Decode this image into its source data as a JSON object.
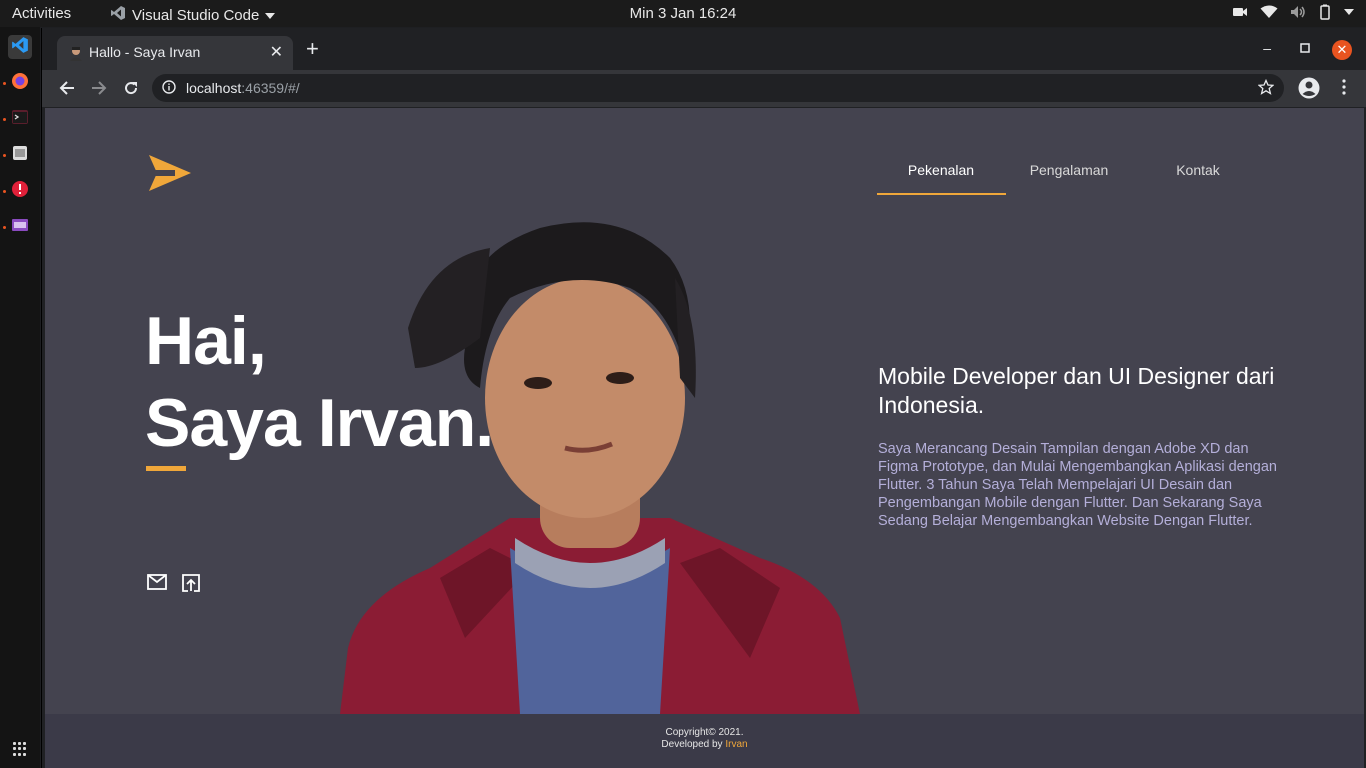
{
  "topbar": {
    "activities": "Activities",
    "app_name": "Visual Studio Code",
    "clock": "Min  3 Jan  16:24"
  },
  "browser": {
    "tab_title": "Hallo - Saya Irvan",
    "url_host": "localhost",
    "url_rest": ":46359/#/"
  },
  "site": {
    "nav": [
      "Pekenalan",
      "Pengalaman",
      "Kontak"
    ],
    "hero_line1": "Hai,",
    "hero_line2": "Saya Irvan.",
    "headline": "Mobile Developer dan UI Designer dari Indonesia.",
    "description": "Saya Merancang Desain Tampilan dengan Adobe XD dan Figma Prototype, dan Mulai Mengembangkan Aplikasi dengan Flutter. 3 Tahun Saya Telah Mempelajari UI Desain dan Pengembangan Mobile dengan Flutter. Dan Sekarang Saya Sedang Belajar Mengembangkan Website Dengan Flutter.",
    "footer_line1": "Copyright© 2021.",
    "footer_prefix": "Developed by ",
    "footer_name": "Irvan"
  },
  "colors": {
    "accent": "#f0a73a",
    "page_bg": "#44434f",
    "footer_bg": "#3b3a48",
    "description": "#b4afd9"
  },
  "icons": [
    "vscode-icon",
    "firefox-icon",
    "terminal-icon",
    "files-icon",
    "error-icon",
    "video-icon",
    "mail-icon",
    "open-in-icon"
  ]
}
